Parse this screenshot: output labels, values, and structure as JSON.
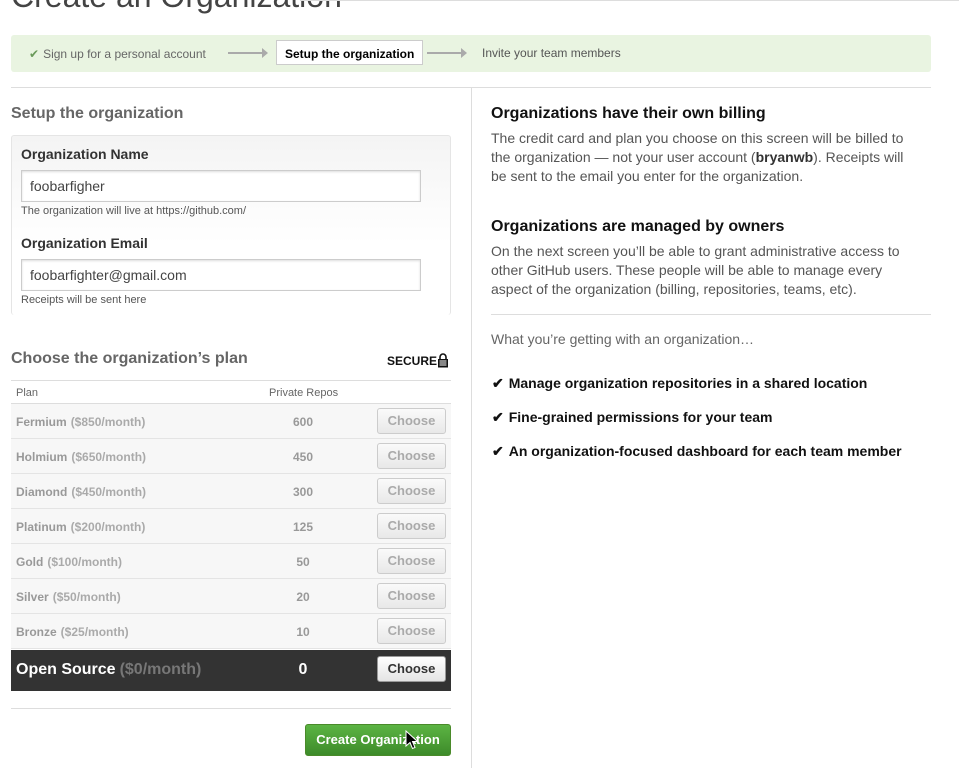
{
  "page": {
    "title": "Create an Organization"
  },
  "steps": {
    "step1": "Sign up for a personal account",
    "step2": "Setup the organization",
    "step3": "Invite your team members"
  },
  "form": {
    "section_title": "Setup the organization",
    "name_label": "Organization Name",
    "name_value": "foobarfigher",
    "name_note": "The organization will live at https://github.com/",
    "email_label": "Organization Email",
    "email_value": "foobarfighter@gmail.com",
    "email_note": "Receipts will be sent here"
  },
  "plans": {
    "title": "Choose the organization’s plan",
    "secure_label": "SECURE",
    "col_plan": "Plan",
    "col_repos": "Private Repos",
    "choose_label": "Choose",
    "rows": [
      {
        "name": "Fermium",
        "price": "($850/month)",
        "repos": "600"
      },
      {
        "name": "Holmium",
        "price": "($650/month)",
        "repos": "450"
      },
      {
        "name": "Diamond",
        "price": "($450/month)",
        "repos": "300"
      },
      {
        "name": "Platinum",
        "price": "($200/month)",
        "repos": "125"
      },
      {
        "name": "Gold",
        "price": "($100/month)",
        "repos": "50"
      },
      {
        "name": "Silver",
        "price": "($50/month)",
        "repos": "20"
      },
      {
        "name": "Bronze",
        "price": "($25/month)",
        "repos": "10"
      },
      {
        "name": "Open Source",
        "price": "($0/month)",
        "repos": "0"
      }
    ]
  },
  "actions": {
    "create_label": "Create Organization"
  },
  "info": {
    "billing_title": "Organizations have their own billing",
    "billing_text_1": "The credit card and plan you choose on this screen will be billed to the organization — not your user account (",
    "billing_user": "bryanwb",
    "billing_text_2": "). Receipts will be sent to the email you enter for the organization.",
    "owners_title": "Organizations are managed by owners",
    "owners_text": "On the next screen you’ll be able to grant administrative access to other GitHub users. These people will be able to manage every aspect of the organization (billing, repositories, teams, etc).",
    "getting": "What you’re getting with an organization…",
    "features": [
      "Manage organization repositories in a shared location",
      "Fine-grained permissions for your team",
      "An organization-focused dashboard for each team member"
    ]
  },
  "colors": {
    "accent_green": "#3d8b2a",
    "steps_bg": "#e9f4e1",
    "selected_row": "#333333"
  },
  "icons": {
    "check": "check-icon",
    "lock": "lock-icon",
    "cursor": "mouse-cursor-icon"
  }
}
